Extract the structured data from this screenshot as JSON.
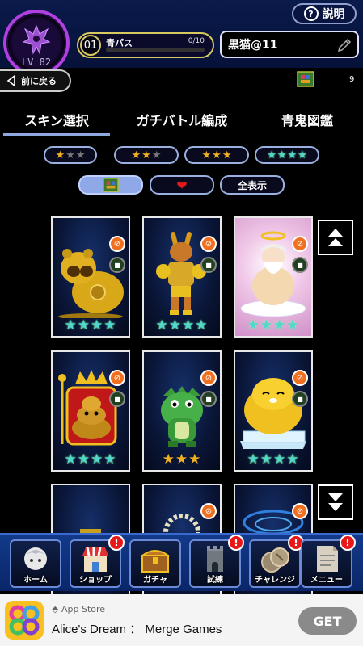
{
  "header": {
    "help_label": "説明",
    "level": "LV 82",
    "pass_number": "01",
    "pass_name": "青パス",
    "pass_progress_text": "0/10",
    "pass_progress": 0,
    "player_name": "黒猫@11",
    "back_label": "前に戻る",
    "coin_count": "9"
  },
  "tabs": [
    {
      "label": "スキン選択",
      "active": true
    },
    {
      "label": "ガチバトル編成",
      "active": false
    },
    {
      "label": "青鬼図鑑",
      "active": false
    }
  ],
  "rarity_filters": [
    {
      "gold": 1,
      "gray": 2
    },
    {
      "gold": 2,
      "gray": 1
    },
    {
      "gold": 3,
      "gray": 0
    },
    {
      "rainbow": 4
    }
  ],
  "type_filters": {
    "all_label": "全表示"
  },
  "cards": [
    {
      "character": "golden-tanuki",
      "stars": 4,
      "star_kind": "rainbow"
    },
    {
      "character": "golden-kangaroo",
      "stars": 4,
      "star_kind": "rainbow"
    },
    {
      "character": "angel-sage",
      "stars": 4,
      "star_kind": "rainbow"
    },
    {
      "character": "king-poop",
      "stars": 4,
      "star_kind": "rainbow"
    },
    {
      "character": "green-crocodile",
      "stars": 3,
      "star_kind": "gold"
    },
    {
      "character": "yellow-seal",
      "stars": 4,
      "star_kind": "rainbow"
    }
  ],
  "nav": [
    {
      "label": "ホーム",
      "icon": "home-icon",
      "alert": false
    },
    {
      "label": "ショップ",
      "icon": "shop-icon",
      "alert": true
    },
    {
      "label": "ガチャ",
      "icon": "gacha-chest-icon",
      "alert": false
    },
    {
      "label": "試練",
      "icon": "tower-icon",
      "alert": true
    },
    {
      "label": "チャレンジ",
      "icon": "coins-icon",
      "alert": true
    },
    {
      "label": "メニュー",
      "icon": "menu-paper-icon",
      "alert": true
    }
  ],
  "alert_mark": "!",
  "ad": {
    "store": "App Store",
    "title": "Alice's Dream ： Merge Games",
    "cta": "GET"
  },
  "colors": {
    "accent_blue": "#8fa8e0",
    "gold_star": "#f0b020",
    "alert_red": "#e81818"
  }
}
